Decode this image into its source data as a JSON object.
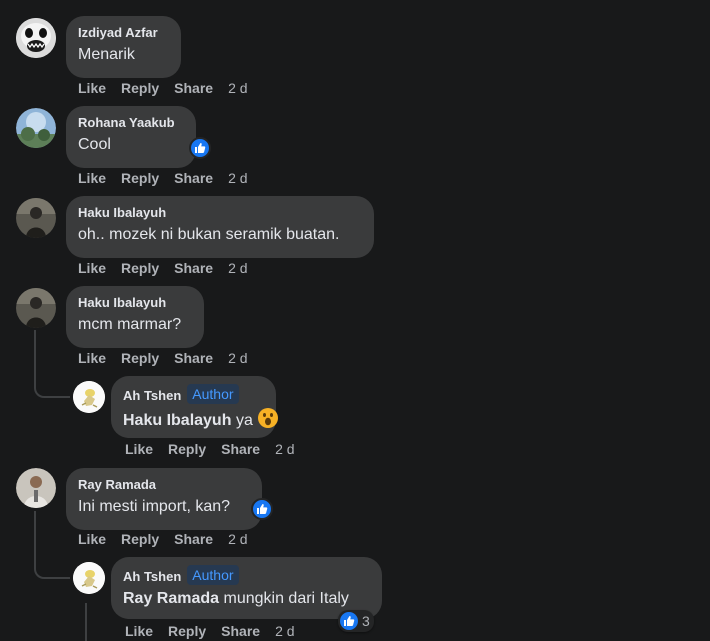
{
  "actions": {
    "like": "Like",
    "reply": "Reply",
    "share": "Share"
  },
  "author_badge": "Author",
  "comments": [
    {
      "author": "Izdiyad Azfar",
      "text": "Menarik",
      "time": "2 d"
    },
    {
      "author": "Rohana Yaakub",
      "text": "Cool",
      "time": "2 d"
    },
    {
      "author": "Haku Ibalayuh",
      "text": "oh.. mozek ni bukan seramik buatan.",
      "time": "2 d"
    },
    {
      "author": "Haku Ibalayuh",
      "text": "mcm marmar?",
      "time": "2 d",
      "reply": {
        "author": "Ah Tshen",
        "mention": "Haku Ibalayuh",
        "text": "ya",
        "time": "2 d"
      }
    },
    {
      "author": "Ray Ramada",
      "text": "Ini mesti import, kan?",
      "time": "2 d",
      "reply": {
        "author": "Ah Tshen",
        "mention": "Ray Ramada",
        "text": "mungkin dari Italy",
        "time": "2 d",
        "reaction_count": "3"
      }
    }
  ]
}
